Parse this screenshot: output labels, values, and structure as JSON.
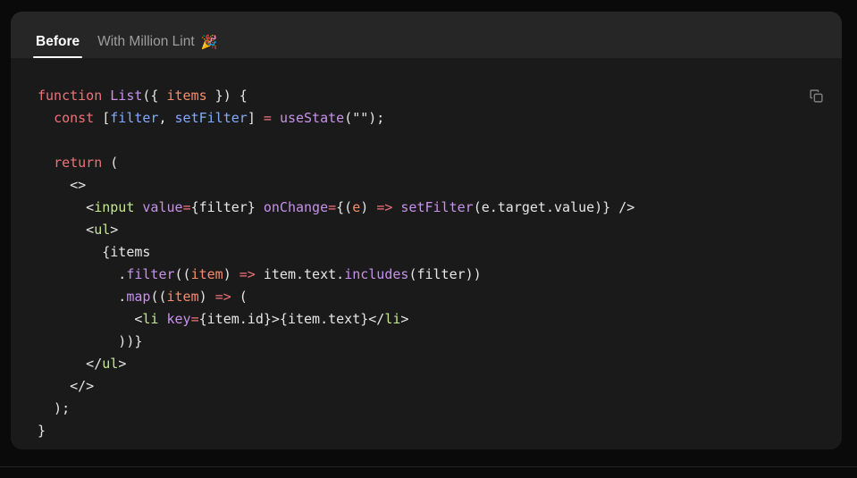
{
  "panel": {
    "tabs": [
      {
        "label": "Before",
        "emoji": "",
        "active": true
      },
      {
        "label": "With Million Lint",
        "emoji": "🎉",
        "active": false
      }
    ],
    "copy_icon": "copy-icon"
  },
  "code": {
    "language": "jsx",
    "lines": [
      [
        {
          "t": "function ",
          "c": "t-kw"
        },
        {
          "t": "List",
          "c": "t-fn"
        },
        {
          "t": "({ ",
          "c": "t-pl"
        },
        {
          "t": "items",
          "c": "t-par"
        },
        {
          "t": " }) {",
          "c": "t-pl"
        }
      ],
      [
        {
          "t": "  ",
          "c": "t-pl"
        },
        {
          "t": "const",
          "c": "t-kw"
        },
        {
          "t": " [",
          "c": "t-pl"
        },
        {
          "t": "filter",
          "c": "t-var"
        },
        {
          "t": ", ",
          "c": "t-pl"
        },
        {
          "t": "setFilter",
          "c": "t-var"
        },
        {
          "t": "] ",
          "c": "t-pl"
        },
        {
          "t": "=",
          "c": "t-op"
        },
        {
          "t": " ",
          "c": "t-pl"
        },
        {
          "t": "useState",
          "c": "t-fn"
        },
        {
          "t": "(\"\");",
          "c": "t-pl"
        }
      ],
      [],
      [
        {
          "t": "  ",
          "c": "t-pl"
        },
        {
          "t": "return",
          "c": "t-kw"
        },
        {
          "t": " (",
          "c": "t-pl"
        }
      ],
      [
        {
          "t": "    <>",
          "c": "t-pl"
        }
      ],
      [
        {
          "t": "      <",
          "c": "t-pl"
        },
        {
          "t": "input",
          "c": "t-tag"
        },
        {
          "t": " ",
          "c": "t-pl"
        },
        {
          "t": "value",
          "c": "t-fn"
        },
        {
          "t": "=",
          "c": "t-op"
        },
        {
          "t": "{filter} ",
          "c": "t-pl"
        },
        {
          "t": "onChange",
          "c": "t-fn"
        },
        {
          "t": "=",
          "c": "t-op"
        },
        {
          "t": "{(",
          "c": "t-pl"
        },
        {
          "t": "e",
          "c": "t-par"
        },
        {
          "t": ") ",
          "c": "t-pl"
        },
        {
          "t": "=>",
          "c": "t-op"
        },
        {
          "t": " ",
          "c": "t-pl"
        },
        {
          "t": "setFilter",
          "c": "t-fn"
        },
        {
          "t": "(e.target.value)} />",
          "c": "t-pl"
        }
      ],
      [
        {
          "t": "      <",
          "c": "t-pl"
        },
        {
          "t": "ul",
          "c": "t-tag"
        },
        {
          "t": ">",
          "c": "t-pl"
        }
      ],
      [
        {
          "t": "        {items",
          "c": "t-pl"
        }
      ],
      [
        {
          "t": "          .",
          "c": "t-pl"
        },
        {
          "t": "filter",
          "c": "t-fn"
        },
        {
          "t": "((",
          "c": "t-pl"
        },
        {
          "t": "item",
          "c": "t-par"
        },
        {
          "t": ") ",
          "c": "t-pl"
        },
        {
          "t": "=>",
          "c": "t-op"
        },
        {
          "t": " item.text.",
          "c": "t-pl"
        },
        {
          "t": "includes",
          "c": "t-fn"
        },
        {
          "t": "(filter))",
          "c": "t-pl"
        }
      ],
      [
        {
          "t": "          .",
          "c": "t-pl"
        },
        {
          "t": "map",
          "c": "t-fn"
        },
        {
          "t": "((",
          "c": "t-pl"
        },
        {
          "t": "item",
          "c": "t-par"
        },
        {
          "t": ") ",
          "c": "t-pl"
        },
        {
          "t": "=>",
          "c": "t-op"
        },
        {
          "t": " (",
          "c": "t-pl"
        }
      ],
      [
        {
          "t": "            <",
          "c": "t-pl"
        },
        {
          "t": "li",
          "c": "t-tag"
        },
        {
          "t": " ",
          "c": "t-pl"
        },
        {
          "t": "key",
          "c": "t-fn"
        },
        {
          "t": "=",
          "c": "t-op"
        },
        {
          "t": "{item.id}>{item.text}</",
          "c": "t-pl"
        },
        {
          "t": "li",
          "c": "t-tag"
        },
        {
          "t": ">",
          "c": "t-pl"
        }
      ],
      [
        {
          "t": "          ))}",
          "c": "t-pl"
        }
      ],
      [
        {
          "t": "      </",
          "c": "t-pl"
        },
        {
          "t": "ul",
          "c": "t-tag"
        },
        {
          "t": ">",
          "c": "t-pl"
        }
      ],
      [
        {
          "t": "    </>",
          "c": "t-pl"
        }
      ],
      [
        {
          "t": "  );",
          "c": "t-pl"
        }
      ],
      [
        {
          "t": "}",
          "c": "t-pl"
        }
      ]
    ]
  },
  "colors": {
    "page_bg": "#0a0a0a",
    "card_bg": "#1a1a1a",
    "tabbar_bg": "#262626",
    "active_tab_text": "#ffffff",
    "inactive_tab_text": "#9e9e9e",
    "keyword": "#f07178",
    "function": "#c792ea",
    "variable": "#82aaff",
    "parameter": "#f78c6c",
    "tag": "#c3e88d",
    "plain": "#e6e6e6",
    "divider": "#242424"
  }
}
